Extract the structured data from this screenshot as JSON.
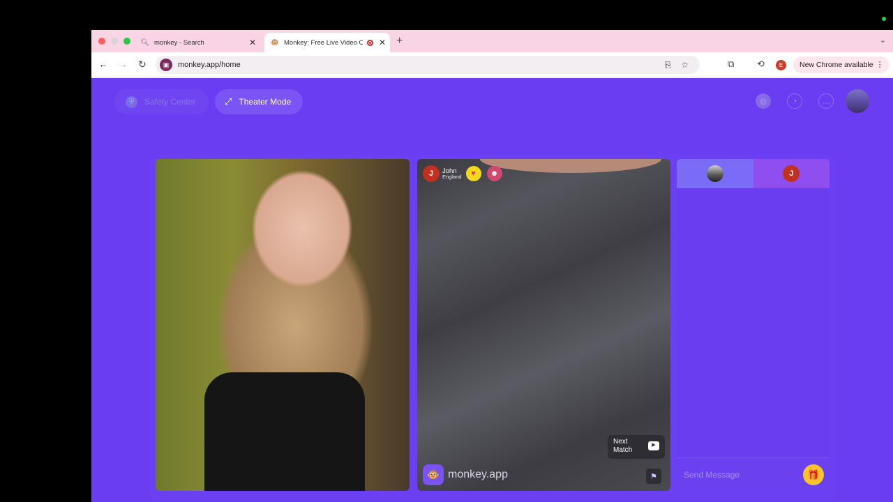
{
  "browser": {
    "tabs": [
      {
        "title": "monkey - Search",
        "favicon": "search-icon"
      },
      {
        "title": "Monkey: Free Live Video C",
        "favicon": "monkey-icon",
        "recording": true
      }
    ],
    "new_tab_symbol": "+",
    "address": "monkey.app/home",
    "profile_initial": "E",
    "new_chrome_label": "New Chrome available"
  },
  "page": {
    "safety_center_label": "Safety Center",
    "theater_mode_label": "Theater Mode",
    "remote_user": {
      "name": "John",
      "country": "England",
      "initial": "J"
    },
    "next_match_label": "Next\nMatch",
    "brand": "monkey.app",
    "chat": {
      "placeholder": "Send Message",
      "partner_initial": "J"
    }
  },
  "colors": {
    "page_bg": "#6a3cf2",
    "tab_strip": "#f9d4e4",
    "gift": "#f6c32a",
    "avatar_red": "#c0311f"
  }
}
